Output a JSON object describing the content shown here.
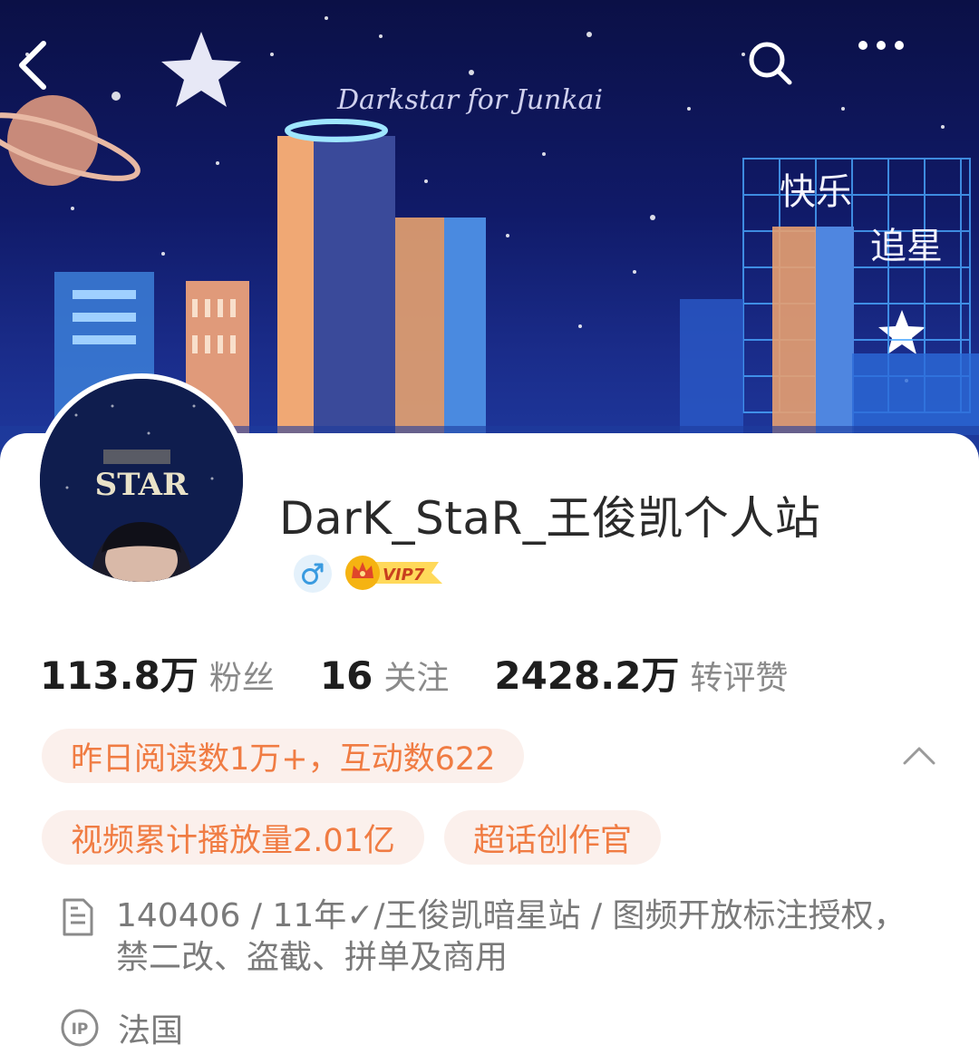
{
  "banner": {
    "signature_text": "Darkstar for Junkai",
    "neon_text_line1": "快乐",
    "neon_text_line2": "追星"
  },
  "header": {
    "back_icon": "chevron-left-icon",
    "search_icon": "search-icon",
    "more_icon": "more-dots-icon"
  },
  "profile": {
    "avatar_text": "STAR",
    "username": "DarK_StaR_王俊凯个人站",
    "gender": "male",
    "vip_label": "VIP7"
  },
  "stats": [
    {
      "value": "113.8万",
      "label": "粉丝"
    },
    {
      "value": "16",
      "label": "关注"
    },
    {
      "value": "2428.2万",
      "label": "转评赞"
    }
  ],
  "highlights": {
    "read_stats": "昨日阅读数1万+，互动数622",
    "video_stats": "视频累计播放量2.01亿",
    "creator_badge": "超话创作官"
  },
  "bio": {
    "text": "140406 / 11年✓/王俊凯暗星站 / 图频开放标注授权，禁二改、盗截、拼单及商用"
  },
  "location": {
    "ip_label": "IP",
    "value": "法国"
  },
  "colors": {
    "pill_bg": "#fbf0ec",
    "pill_text": "#f07c43",
    "banner_bg": "#101a68",
    "gender_blue": "#3a9be0",
    "vip_gold": "#f5b312"
  }
}
